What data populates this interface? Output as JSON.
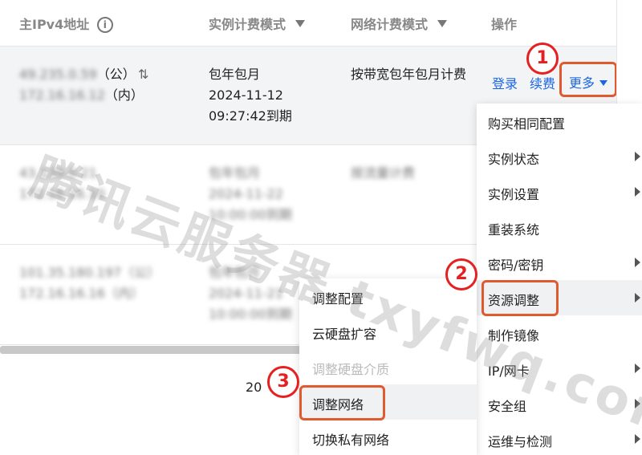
{
  "header": {
    "ip_col": "主IPv4地址",
    "bill_col": "实例计费模式",
    "net_col": "网络计费模式",
    "op_col": "操作"
  },
  "rows": [
    {
      "ip_public": "49.235.0.59",
      "public_tag": "（公）",
      "ip_private": "172.16.16.12",
      "private_tag": "（内）",
      "billing": "包年包月",
      "expiry_date": "2024-11-12",
      "expiry_time": "09:27:42到期",
      "network": "按带宽包年包月计费"
    },
    {
      "ip_public": "43.139.0.21",
      "ip_private": "172.16.16.10",
      "billing": "包年包月",
      "expiry_date": "2024-11-22",
      "expiry_time": "10:00:00到期",
      "network": "按流量计费"
    },
    {
      "ip_public": "101.35.180.197",
      "public_tag": "（公）",
      "ip_private": "172.16.16.16",
      "private_tag": "（内）",
      "billing": "包年包月",
      "expiry_date": "2024-11-21",
      "expiry_time": "10:00:00到期"
    }
  ],
  "ops": {
    "login": "登录",
    "renew": "续费",
    "more": "更多"
  },
  "pager": {
    "page_size": "20"
  },
  "badges": {
    "b1": "1",
    "b2": "2",
    "b3": "3"
  },
  "menu": {
    "items": [
      {
        "label": "购买相同配置",
        "has_sub": false
      },
      {
        "label": "实例状态",
        "has_sub": true
      },
      {
        "label": "实例设置",
        "has_sub": true
      },
      {
        "label": "重装系统",
        "has_sub": false
      },
      {
        "label": "密码/密钥",
        "has_sub": true
      },
      {
        "label": "资源调整",
        "has_sub": true
      },
      {
        "label": "制作镜像",
        "has_sub": false
      },
      {
        "label": "IP/网卡",
        "has_sub": true
      },
      {
        "label": "安全组",
        "has_sub": true
      },
      {
        "label": "运维与检测",
        "has_sub": true
      }
    ]
  },
  "submenu": {
    "items": [
      {
        "label": "调整配置"
      },
      {
        "label": "云硬盘扩容"
      },
      {
        "label": "调整硬盘介质",
        "disabled": true
      },
      {
        "label": "调整网络"
      },
      {
        "label": "切换私有网络"
      }
    ]
  },
  "watermark": "腾讯云服务器 txyfwq.com",
  "colors": {
    "link": "#1a66e0",
    "highlight": "#e05a30",
    "badge": "#e52020"
  }
}
